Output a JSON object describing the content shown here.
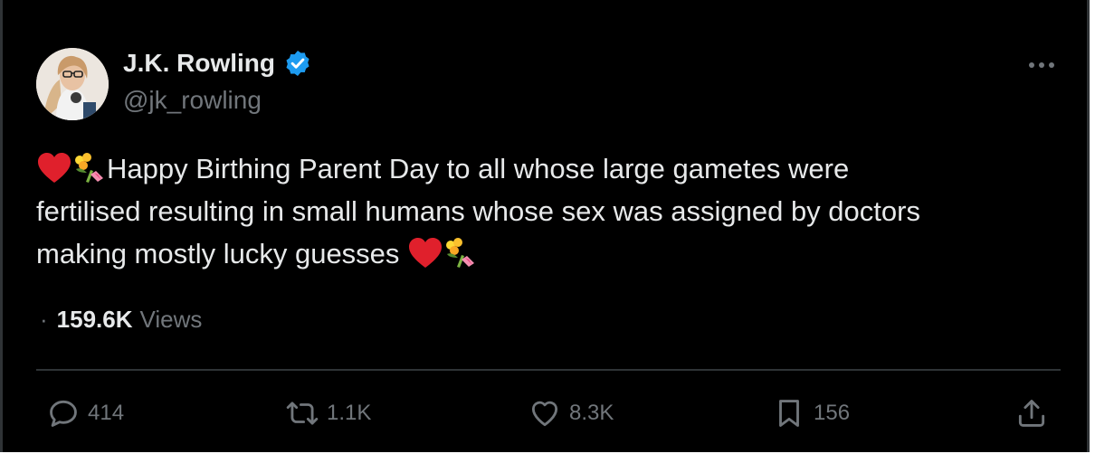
{
  "author": {
    "name": "J.K. Rowling",
    "handle": "@jk_rowling",
    "verified_color": "#1d9bf0"
  },
  "tweet": {
    "line1": "Happy Birthing Parent Day to all whose large gametes were",
    "line2": "fertilised resulting in small humans whose sex was assigned by doctors",
    "line3": "making mostly lucky guesses",
    "emojis": [
      "red-heart-icon",
      "bouquet-icon"
    ]
  },
  "meta": {
    "separator": "·",
    "views_count": "159.6K",
    "views_label": "Views"
  },
  "actions": {
    "replies": "414",
    "reposts": "1.1K",
    "likes": "8.3K",
    "bookmarks": "156"
  },
  "colors": {
    "background": "#000000",
    "text": "#e7e9ea",
    "muted": "#71767b",
    "divider": "#2f3336"
  }
}
